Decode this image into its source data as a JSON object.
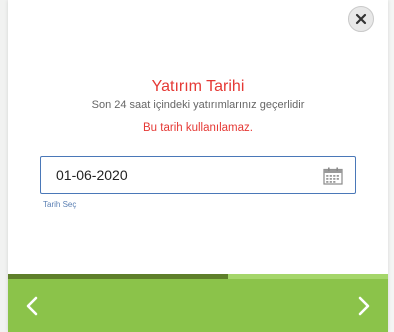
{
  "modal": {
    "title": "Yatırım Tarihi",
    "subtitle": "Son 24 saat içindeki yatırımlarınız geçerlidir",
    "error": "Bu tarih kullanılamaz.",
    "date_field": {
      "value": "01-06-2020",
      "label": "Tarih Seç",
      "icon": "calendar-icon"
    },
    "close_icon": "close-icon",
    "progress_fraction": 0.58,
    "footer": {
      "prev_icon": "chevron-left-icon",
      "next_icon": "chevron-right-icon"
    }
  },
  "colors": {
    "accent_red": "#e53935",
    "field_border": "#4a78b8",
    "footer_green": "#8bc34a",
    "progress_dark": "#5e7f2a",
    "progress_light": "#a5d66a"
  }
}
